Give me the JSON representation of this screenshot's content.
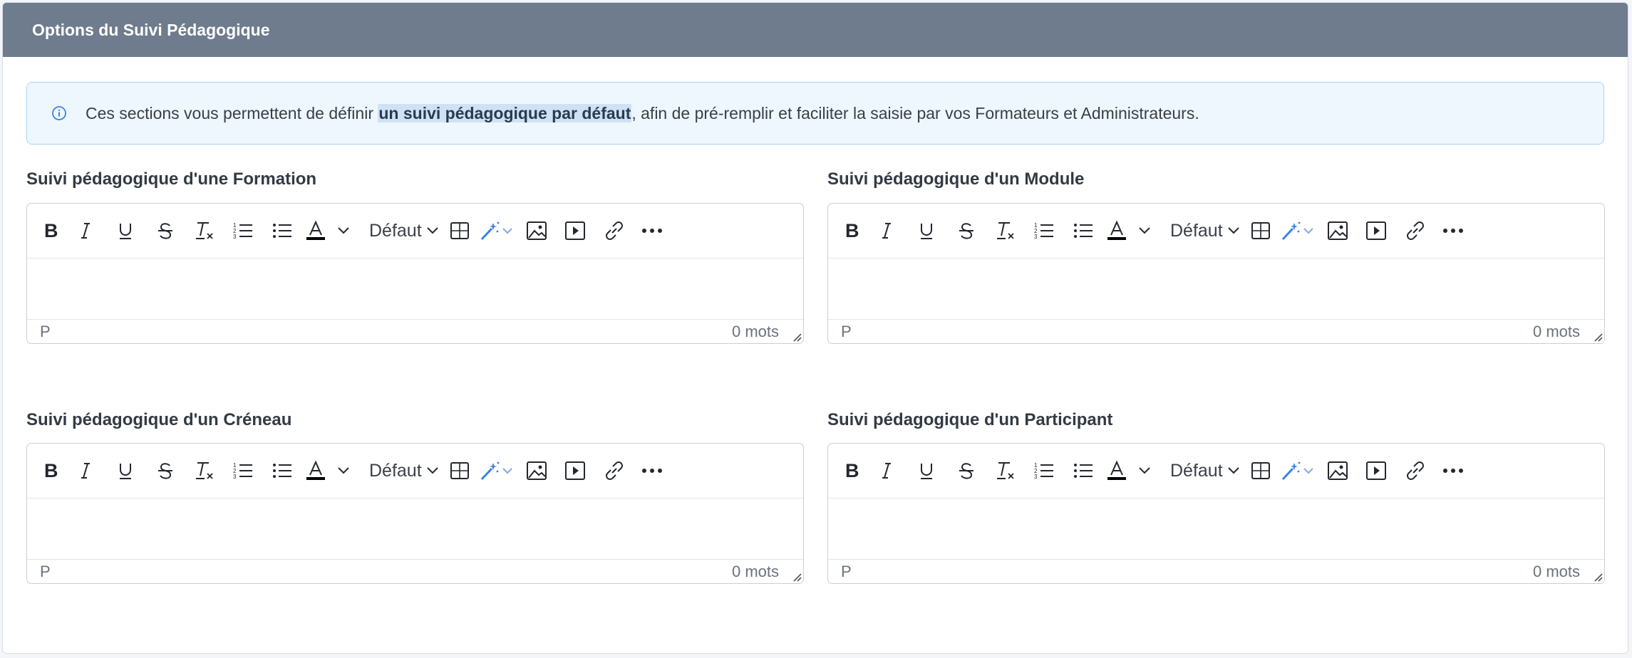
{
  "panel": {
    "title": "Options du Suivi Pédagogique"
  },
  "info": {
    "icon": "info-circle-icon",
    "text_before": "Ces sections vous permettent de définir ",
    "text_highlight": "un suivi pédagogique par défaut",
    "text_after": ", afin de pré-remplir et faciliter la saisie par vos Formateurs et Administrateurs."
  },
  "editors": [
    {
      "label": "Suivi pédagogique d'une Formation",
      "format": "Défaut",
      "path": "P",
      "word_count": "0 mots"
    },
    {
      "label": "Suivi pédagogique d'un Module",
      "format": "Défaut",
      "path": "P",
      "word_count": "0 mots"
    },
    {
      "label": "Suivi pédagogique d'un Créneau",
      "format": "Défaut",
      "path": "P",
      "word_count": "0 mots"
    },
    {
      "label": "Suivi pédagogique d'un Participant",
      "format": "Défaut",
      "path": "P",
      "word_count": "0 mots"
    }
  ],
  "toolbar_buttons": [
    "bold-icon",
    "italic-icon",
    "underline-icon",
    "strikethrough-icon",
    "clear-formatting-icon",
    "numbered-list-icon",
    "bulleted-list-icon",
    "text-color-icon",
    "chevron-down-icon",
    "format-select",
    "table-icon",
    "magic-wand-icon",
    "image-icon",
    "media-icon",
    "link-icon",
    "more-icon"
  ],
  "colors": {
    "header": "#6e7c8d",
    "info_bg": "#eef7fe",
    "info_border": "#a9d3f0",
    "accent": "#3b82e6"
  }
}
